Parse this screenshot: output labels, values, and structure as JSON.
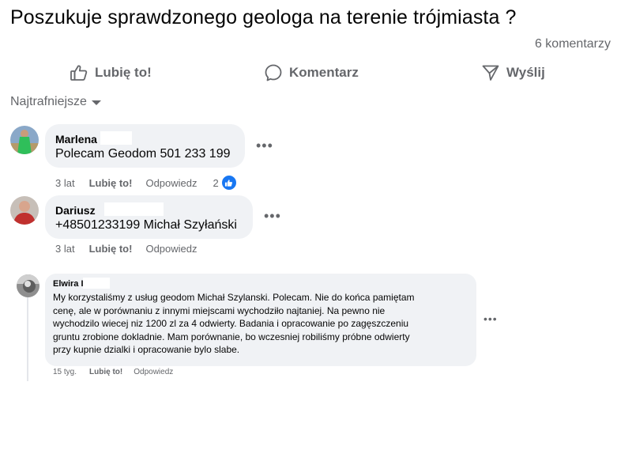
{
  "post": {
    "title": "Poszukuje sprawdzonego geologa na terenie trójmiasta ?",
    "comments_count": "6 komentarzy"
  },
  "actions": {
    "like": "Lubię to!",
    "comment": "Komentarz",
    "share": "Wyślij"
  },
  "sort": {
    "label": "Najtrafniejsze"
  },
  "comments": [
    {
      "author": "Marlena",
      "text": "Polecam Geodom 501 233 199",
      "time": "3 lat",
      "like": "Lubię to!",
      "reply": "Odpowiedz",
      "reaction_count": "2"
    },
    {
      "author": "Dariusz",
      "text": "+48501233199 Michał Szyłański",
      "time": "3 lat",
      "like": "Lubię to!",
      "reply": "Odpowiedz"
    },
    {
      "author": "Elwira I",
      "text_lines": [
        "My korzystaliśmy z usług geodom Michał Szylanski. Polecam. Nie do końca pamiętam",
        "cenę, ale w porównaniu z innymi miejscami wychodziło najtaniej. Na pewno nie",
        "wychodzilo wiecej niz 1200 zl za 4 odwierty. Badania i opracowanie po zagęszczeniu",
        "gruntu zrobione dokladnie. Mam porównanie, bo wczesniej robiliśmy próbne odwierty",
        "przy kupnie dzialki i opracowanie bylo slabe."
      ],
      "time": "15 tyg.",
      "like": "Lubię to!",
      "reply": "Odpowiedz"
    }
  ],
  "colors": {
    "bubble": "#f0f2f5",
    "secondary_text": "#65676b",
    "like_blue": "#1877f2"
  }
}
